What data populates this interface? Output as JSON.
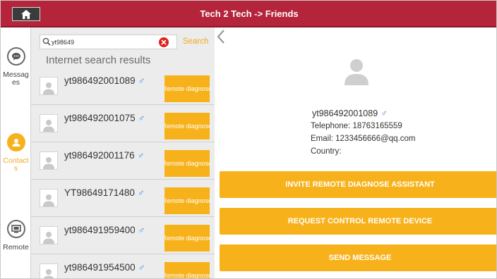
{
  "header": {
    "title": "Tech 2 Tech -> Friends",
    "home_icon": "home-icon"
  },
  "rail": {
    "items": [
      {
        "label": "Messages",
        "icon": "chat-bubble-icon",
        "active": false
      },
      {
        "label": "Contacts",
        "icon": "person-icon",
        "active": true
      },
      {
        "label": "Remote",
        "icon": "monitor-icon",
        "active": false
      }
    ]
  },
  "search": {
    "value": "yt98649",
    "search_label": "Search",
    "results_heading": "Internet search results"
  },
  "results": [
    {
      "name": "yt986492001089",
      "gender": "♂",
      "action": "Remote diagnose"
    },
    {
      "name": "yt986492001075",
      "gender": "♂",
      "action": "Remote diagnose"
    },
    {
      "name": "yt986492001176",
      "gender": "♂",
      "action": "Remote diagnose"
    },
    {
      "name": "YT98649171480",
      "gender": "♂",
      "action": "Remote diagnose"
    },
    {
      "name": "yt986491959400",
      "gender": "♂",
      "action": "Remote diagnose"
    },
    {
      "name": "yt986491954500",
      "gender": "♂",
      "action": "Remote diagnose"
    }
  ],
  "detail": {
    "name": "yt986492001089",
    "gender": "♂",
    "telephone": "Telephone: 18763165559",
    "email": "Email: 1233456666@qq.com",
    "country": "Country:",
    "buttons": {
      "invite": "INVITE REMOTE DIAGNOSE ASSISTANT",
      "request": "REQUEST CONTROL REMOTE DEVICE",
      "message": "SEND MESSAGE"
    }
  },
  "colors": {
    "header": "#b4243a",
    "accent": "#f7b21b",
    "gender": "#3a8ee6",
    "clear": "#e0201b"
  }
}
